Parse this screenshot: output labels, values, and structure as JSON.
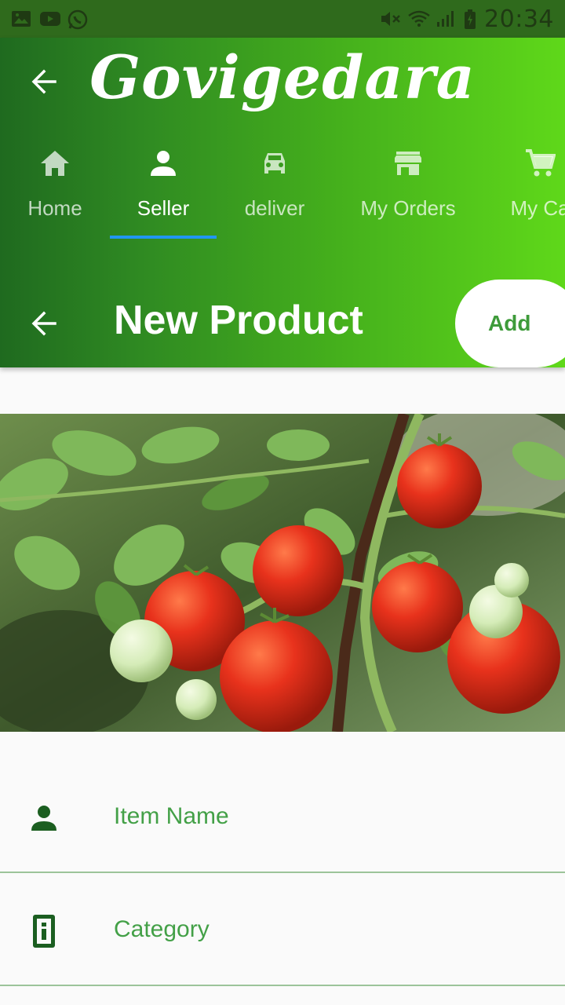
{
  "status_bar": {
    "time": "20:34",
    "left_icons": [
      "gallery-icon",
      "youtube-icon",
      "whatsapp-icon"
    ],
    "right_icons": [
      "mute-icon",
      "wifi-icon",
      "signal-icon",
      "battery-icon"
    ]
  },
  "header": {
    "brand": "Govigedara",
    "tabs": [
      {
        "label": "Home",
        "icon": "home-icon",
        "active": false
      },
      {
        "label": "Seller",
        "icon": "person-icon",
        "active": true
      },
      {
        "label": "deliver",
        "icon": "car-icon",
        "active": false
      },
      {
        "label": "My Orders",
        "icon": "store-icon",
        "active": false
      },
      {
        "label": "My Ca",
        "icon": "cart-icon",
        "active": false
      }
    ],
    "page_title": "New Product",
    "add_label": "Add"
  },
  "form": {
    "item_name_label": "Item Name",
    "category_label": "Category"
  },
  "colors": {
    "accent_green": "#43a047",
    "tab_indicator": "#2196f3",
    "header_start": "#1f6a1f",
    "header_end": "#5fd81a"
  }
}
